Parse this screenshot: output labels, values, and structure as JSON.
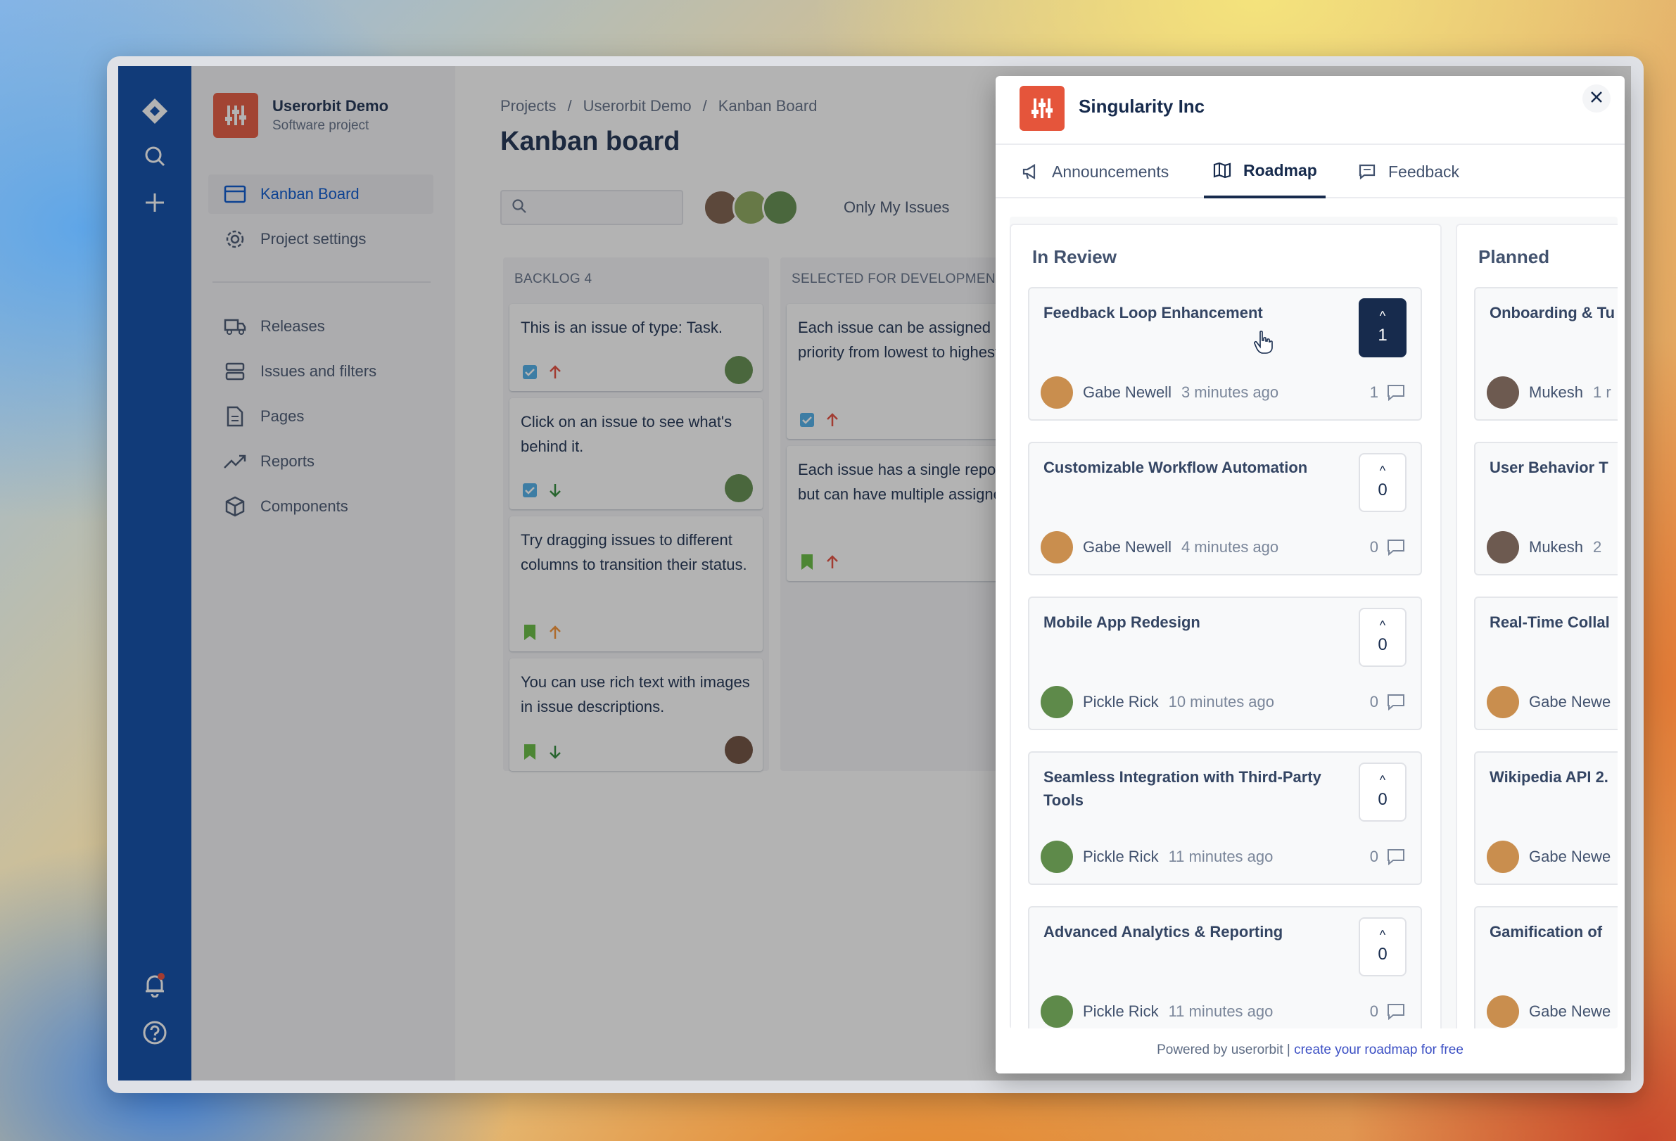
{
  "sidebar": {
    "project_name": "Userorbit Demo",
    "project_type": "Software project",
    "items": [
      {
        "label": "Kanban Board",
        "icon": "board-icon",
        "active": true
      },
      {
        "label": "Project settings",
        "icon": "gear-icon"
      },
      {
        "label": "Releases",
        "icon": "truck-icon"
      },
      {
        "label": "Issues and filters",
        "icon": "stack-icon"
      },
      {
        "label": "Pages",
        "icon": "page-icon"
      },
      {
        "label": "Reports",
        "icon": "trend-icon"
      },
      {
        "label": "Components",
        "icon": "box-icon"
      }
    ]
  },
  "breadcrumb": [
    "Projects",
    "Userorbit Demo",
    "Kanban Board"
  ],
  "board": {
    "title": "Kanban board",
    "only_my_issues": "Only My Issues",
    "columns": [
      {
        "title": "BACKLOG 4",
        "cards": [
          {
            "text": "This is an issue of type: Task.",
            "type": "task",
            "priority": "up"
          },
          {
            "text": "Click on an issue to see what's behind it.",
            "type": "task",
            "priority": "down"
          },
          {
            "text": "Try dragging issues to different columns to transition their status.",
            "type": "story",
            "priority": "up"
          },
          {
            "text": "You can use rich text with images in issue descriptions.",
            "type": "story",
            "priority": "down"
          }
        ]
      },
      {
        "title": "SELECTED FOR DEVELOPMENT",
        "cards": [
          {
            "text": "Each issue can be assigned priority from lowest to highest.",
            "type": "task",
            "priority": "up"
          },
          {
            "text": "Each issue has a single reporter but can have multiple assignees.",
            "type": "story",
            "priority": "up"
          }
        ]
      }
    ]
  },
  "panel": {
    "org_name": "Singularity Inc",
    "tabs": [
      {
        "label": "Announcements",
        "icon": "megaphone-icon"
      },
      {
        "label": "Roadmap",
        "icon": "map-icon",
        "active": true
      },
      {
        "label": "Feedback",
        "icon": "chat-icon"
      }
    ],
    "columns": [
      {
        "title": "In Review",
        "cards": [
          {
            "title": "Feedback Loop Enhancement",
            "votes": "1",
            "voted": true,
            "author": "Gabe Newell",
            "time": "3 minutes ago",
            "comments": "1"
          },
          {
            "title": "Customizable Workflow Automation",
            "votes": "0",
            "author": "Gabe Newell",
            "time": "4 minutes ago",
            "comments": "0"
          },
          {
            "title": "Mobile App Redesign",
            "votes": "0",
            "author": "Pickle Rick",
            "time": "10 minutes ago",
            "comments": "0"
          },
          {
            "title": "Seamless Integration with Third-Party Tools",
            "votes": "0",
            "author": "Pickle Rick",
            "time": "11 minutes ago",
            "comments": "0"
          },
          {
            "title": "Advanced Analytics & Reporting",
            "votes": "0",
            "author": "Pickle Rick",
            "time": "11 minutes ago",
            "comments": "0"
          }
        ]
      },
      {
        "title": "Planned",
        "cards": [
          {
            "title": "Onboarding & Tu",
            "author": "Mukesh",
            "time": "1 r"
          },
          {
            "title": "User Behavior T",
            "author": "Mukesh",
            "time": "2"
          },
          {
            "title": "Real-Time Collal",
            "author": "Gabe Newe",
            "time": ""
          },
          {
            "title": "Wikipedia API 2.",
            "author": "Gabe Newe",
            "time": ""
          },
          {
            "title": "Gamification of",
            "author": "Gabe Newe",
            "time": ""
          }
        ]
      }
    ],
    "footer_text": "Powered by userorbit |",
    "footer_link": "create your roadmap for free"
  },
  "colors": {
    "rail": "#0747a6",
    "brand_logo": "#e5553b",
    "vote_active": "#172b4d",
    "link": "#3b4fc4"
  }
}
